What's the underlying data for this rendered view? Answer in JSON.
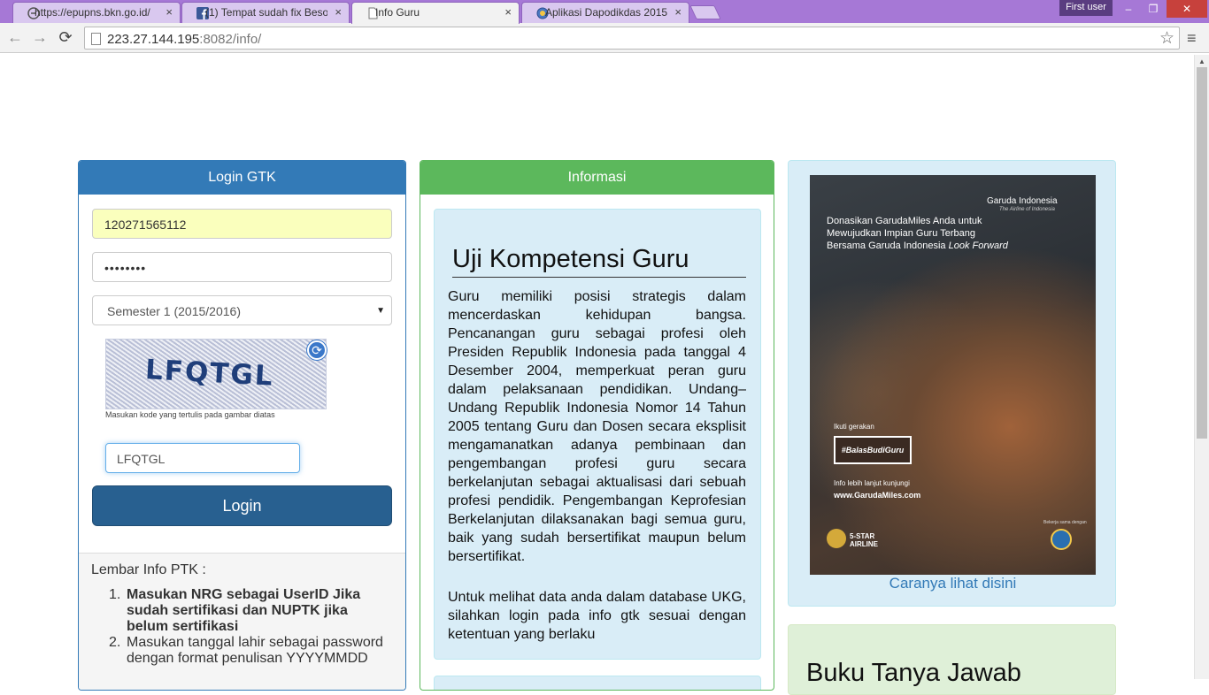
{
  "browser": {
    "tabs": [
      {
        "title": "https://epupns.bkn.go.id/",
        "icon": "page-icon"
      },
      {
        "title": "(1) Tempat sudah fix Besok",
        "icon": "facebook-icon"
      },
      {
        "title": "Info Guru",
        "icon": "page-icon"
      },
      {
        "title": "Aplikasi Dapodikdas 2015",
        "icon": "globe-icon"
      }
    ],
    "close_glyph": "×",
    "user": "First user",
    "window_controls": {
      "minimize": "–",
      "restore": "❐",
      "close": "✕"
    },
    "nav": {
      "back": "←",
      "forward": "→",
      "reload": "⟳"
    },
    "url_host": "223.27.144.195",
    "url_rest": ":8082/info/",
    "star": "☆",
    "menu": "≡"
  },
  "login": {
    "title": "Login GTK",
    "username": "120271565112",
    "password": "••••••••",
    "semester": "Semester 1 (2015/2016)",
    "captcha_text": "LFQTGL",
    "captcha_hint": "Masukan kode yang tertulis pada gambar diatas",
    "captcha_value": "LFQTGL",
    "button": "Login",
    "info_title": "Lembar Info PTK :",
    "info_items": [
      "Masukan NRG sebagai UserID Jika sudah sertifikasi dan NUPTK jika belum sertifikasi",
      "Masukan tanggal lahir sebagai password dengan format penulisan YYYYMMDD"
    ]
  },
  "informasi": {
    "title": "Informasi",
    "heading": "Uji Kompetensi Guru",
    "para1": "Guru memiliki posisi strategis dalam mencerdaskan kehidupan bangsa. Pencanangan guru sebagai profesi oleh Presiden Republik Indonesia pada tanggal 4 Desember 2004, memperkuat peran guru dalam pelaksanaan pendidikan. Undang–Undang Republik Indonesia Nomor 14 Tahun 2005 tentang Guru dan Dosen secara eksplisit mengamanatkan adanya pembinaan dan pengembangan profesi guru secara berkelanjutan sebagai aktualisasi dari sebuah profesi pendidik. Pengembangan Keprofesian Berkelanjutan dilaksanakan bagi semua guru, baik yang sudah bersertifikat maupun belum bersertifikat.",
    "para2": "Untuk melihat data anda dalam database UKG, silahkan login pada info gtk sesuai dengan ketentuan yang berlaku"
  },
  "ad": {
    "brand": "Garuda Indonesia",
    "brand_sub": "The Airline of Indonesia",
    "headline1": "Donasikan GarudaMiles Anda untuk",
    "headline2": "Mewujudkan Impian Guru Terbang",
    "headline3": "Bersama Garuda Indonesia",
    "headline3b": "Look Forward",
    "ikuti": "Ikuti gerakan",
    "hashtag": "#BalasBudiGuru",
    "info": "Info lebih lanjut kunjungi",
    "url": "www.GarudaMiles.com",
    "stars": "5-STAR",
    "airline": "AIRLINE",
    "partner": "Bekerja sama dengan",
    "link": "Caranya lihat disini"
  },
  "buku": {
    "title": "Buku Tanya Jawab"
  }
}
